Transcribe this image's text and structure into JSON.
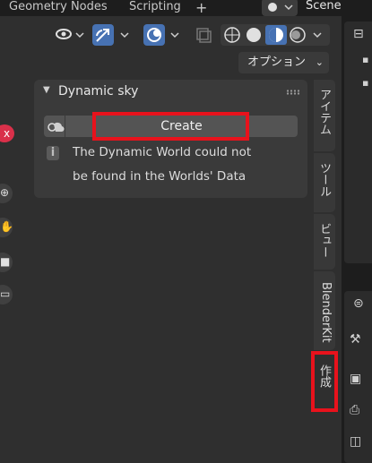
{
  "topbar": {
    "tabs": [
      "Geometry Nodes",
      "Scripting"
    ],
    "add_tab": "+",
    "scene": "Scene"
  },
  "viewport": {
    "options_label": "オプション",
    "close_badge": "x",
    "shading_active": 2
  },
  "panel": {
    "title": "Dynamic sky",
    "create_label": "Create",
    "info_icon": "i",
    "info_lines": [
      "The Dynamic World could not",
      "be found in the Worlds' Data"
    ]
  },
  "sidebar_tabs": [
    {
      "label": "アイテム"
    },
    {
      "label": "ツール"
    },
    {
      "label": "ビュー"
    },
    {
      "label": "BlenderKit"
    },
    {
      "label": "作成"
    }
  ],
  "icons": {
    "viewport_tools": [
      "visibility-icon",
      "gizmo-icon",
      "overlay-icon",
      "xray-icon"
    ],
    "shading": [
      "wireframe-icon",
      "solid-icon",
      "material-preview-icon",
      "rendered-icon"
    ],
    "gizmos": [
      "zoom-icon",
      "pan-hand-icon",
      "camera-icon",
      "perspective-icon"
    ],
    "properties": [
      "tool-icon",
      "render-icon",
      "output-icon",
      "view-layer-icon"
    ]
  },
  "colors": {
    "highlight": "#e8121c",
    "accent": "#4772b3",
    "danger": "#d9304a"
  }
}
